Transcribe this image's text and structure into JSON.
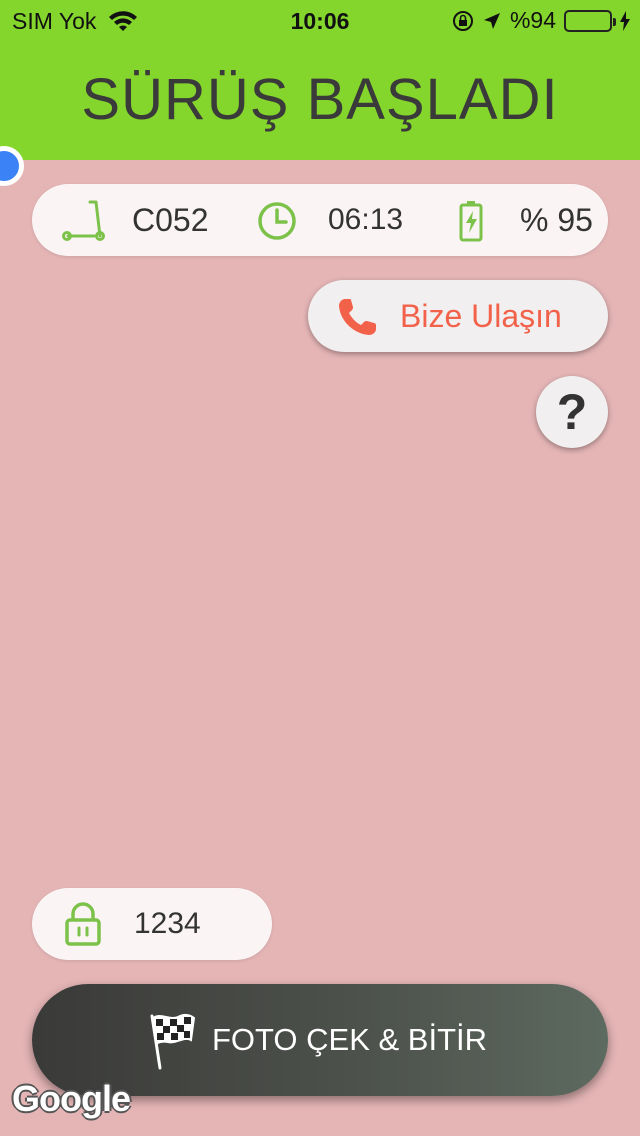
{
  "status_bar": {
    "carrier": "SIM Yok",
    "time": "10:06",
    "battery_percent": "%94",
    "battery_level": 0.94
  },
  "header": {
    "title": "SÜRÜŞ BAŞLADI",
    "background": "#84d52c"
  },
  "ride_info": {
    "vehicle_id": "C052",
    "duration": "06:13",
    "battery": "% 95",
    "icon_color": "#7cc24a"
  },
  "contact_button": {
    "label": "Bize Ulaşın",
    "color": "#f2624b"
  },
  "help_button": {
    "label": "?"
  },
  "lock": {
    "code": "1234"
  },
  "finish_button": {
    "label": "FOTO ÇEK & BİTİR"
  },
  "map": {
    "attribution": "Google",
    "background": "#e5b5b6"
  }
}
